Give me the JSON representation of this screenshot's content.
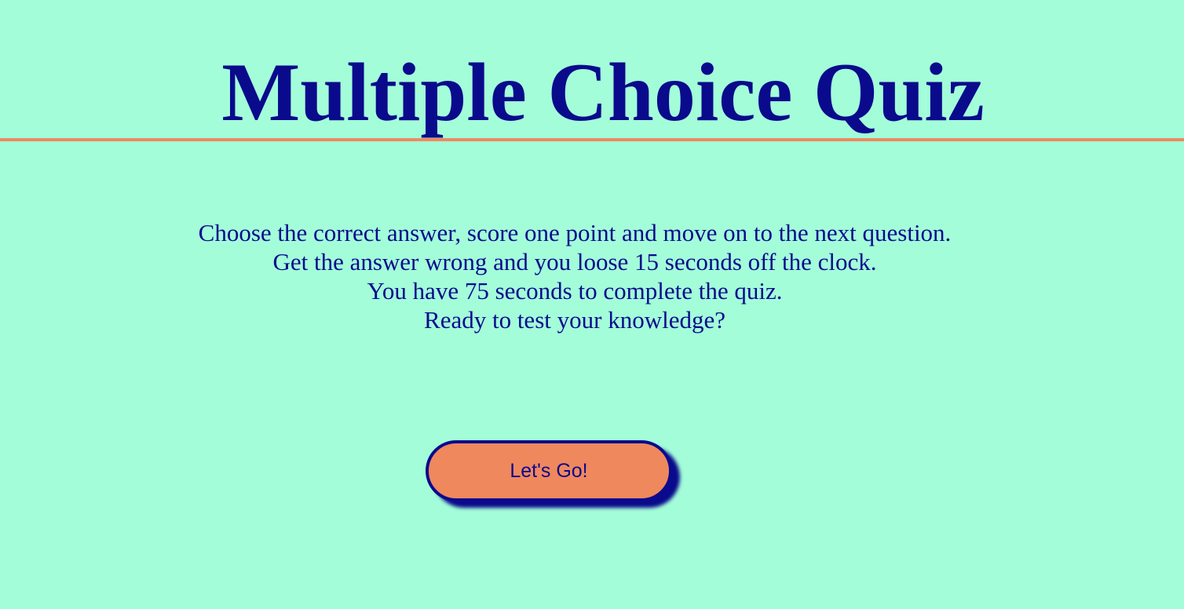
{
  "header": {
    "title": "Multiple Choice Quiz"
  },
  "intro": {
    "lines": [
      "Choose the correct answer, score one point and move on to the next question.",
      "Get the answer wrong and you loose 15 seconds off the clock.",
      "You have 75 seconds to complete the quiz.",
      "Ready to test your knowledge?"
    ]
  },
  "start_button": {
    "label": "Let's Go!"
  },
  "colors": {
    "background": "#a3fdd9",
    "text": "#0a0a8c",
    "accent": "#f0885e",
    "divider": "#ee8a5d"
  }
}
